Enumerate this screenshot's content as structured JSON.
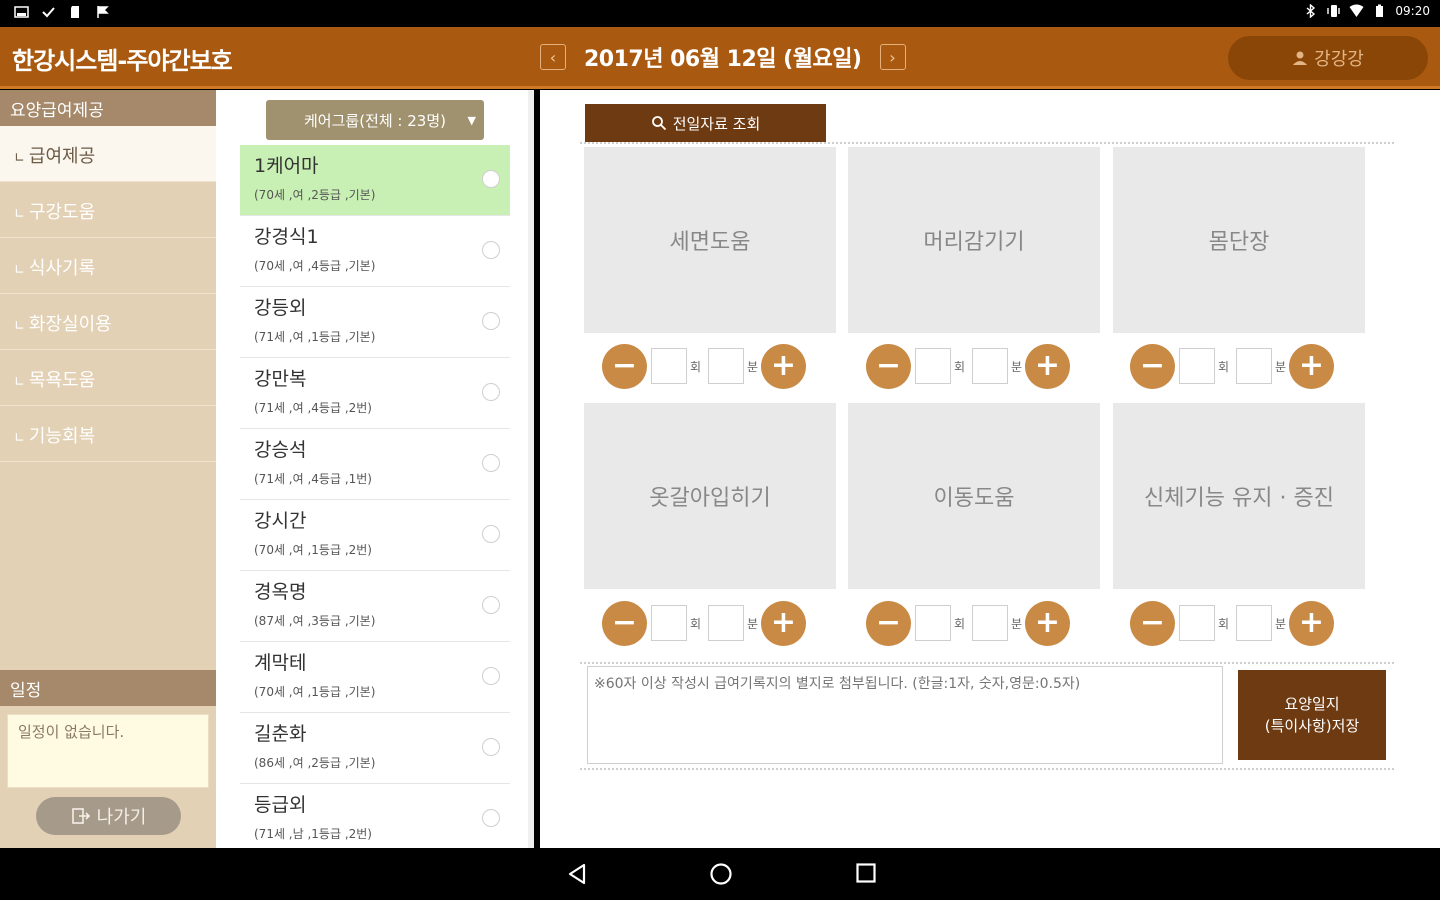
{
  "status_bar": {
    "time": "09:20"
  },
  "header": {
    "app_title": "한강시스템-주야간보호",
    "date_text": "2017년 06월 12일 (월요일)",
    "prev_arrow": "‹",
    "next_arrow": "›",
    "user_name": "강강강"
  },
  "sidebar": {
    "section_title": "요양급여제공",
    "items": [
      {
        "label": "급여제공"
      },
      {
        "label": "구강도움"
      },
      {
        "label": "식사기록"
      },
      {
        "label": "화장실이용"
      },
      {
        "label": "목욕도움"
      },
      {
        "label": "기능회복"
      }
    ],
    "schedule_title": "일정",
    "schedule_empty": "일정이 없습니다.",
    "exit_label": "나가기"
  },
  "care_list": {
    "group_label": "케어그룹(전체 : 23명)",
    "rows": [
      {
        "name": "1케어마",
        "info": "(70세 ,여 ,2등급 ,기본)"
      },
      {
        "name": "강경식1",
        "info": "(70세 ,여 ,4등급 ,기본)"
      },
      {
        "name": "강등외",
        "info": "(71세 ,여 ,1등급 ,기본)"
      },
      {
        "name": "강만복",
        "info": "(71세 ,여 ,4등급 ,2번)"
      },
      {
        "name": "강승석",
        "info": "(71세 ,여 ,4등급 ,1번)"
      },
      {
        "name": "강시간",
        "info": "(70세 ,여 ,1등급 ,2번)"
      },
      {
        "name": "경옥명",
        "info": "(87세 ,여 ,3등급 ,기본)"
      },
      {
        "name": "계막테",
        "info": "(70세 ,여 ,1등급 ,기본)"
      },
      {
        "name": "길춘화",
        "info": "(86세 ,여 ,2등급 ,기본)"
      },
      {
        "name": "등급외",
        "info": "(71세 ,남 ,1등급 ,2번)"
      }
    ]
  },
  "main": {
    "prev_data_label": "전일자료 조회",
    "tiles": [
      {
        "label": "세면도움"
      },
      {
        "label": "머리감기기"
      },
      {
        "label": "몸단장"
      },
      {
        "label": "옷갈아입히기"
      },
      {
        "label": "이동도움"
      },
      {
        "label": "신체기능 유지 · 증진"
      }
    ],
    "count_unit": "회",
    "minute_unit": "분",
    "minus": "−",
    "plus": "+",
    "memo_placeholder": "※60자 이상 작성시 급여기록지의 별지로 첨부됩니다. (한글:1자, 숫자,영문:0.5자)",
    "save_line1": "요양일지",
    "save_line2": "(특이사항)저장"
  }
}
